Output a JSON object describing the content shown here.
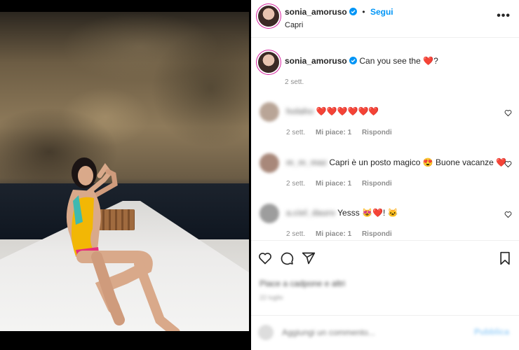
{
  "post": {
    "username": "sonia_amoruso",
    "follow_label": "Segui",
    "location": "Capri",
    "more_label": "•••"
  },
  "caption": {
    "username": "sonia_amoruso",
    "text": "Can you see the",
    "emoji": "❤️",
    "suffix": "?",
    "time": "2 sett."
  },
  "comments": [
    {
      "author": "holaho",
      "text": "❤️❤️❤️❤️❤️❤️",
      "time": "2 sett.",
      "likes": "Mi piace: 1",
      "reply": "Rispondi"
    },
    {
      "author": "m_m_maz",
      "text": "Capri è un posto magico 😍 Buone vacanze ❤️",
      "time": "2 sett.",
      "likes": "Mi piace: 1",
      "reply": "Rispondi"
    },
    {
      "author": "a.ciel_dauro",
      "text": "Yesss 😻❤️! 🐱",
      "time": "2 sett.",
      "likes": "Mi piace: 1",
      "reply": "Rispondi"
    }
  ],
  "engagement": {
    "likes_text": "Piace a cadpone e altri",
    "date_text": "22 luglio"
  },
  "add_comment": {
    "placeholder": "Aggiungi un commento...",
    "post_label": "Pubblica"
  },
  "colors": {
    "accent": "#0095f6",
    "heart": "#e0245e",
    "meta": "#8e8e8e"
  },
  "icons": [
    "verified-icon",
    "more-icon",
    "heart-icon",
    "comment-icon",
    "share-icon",
    "save-icon",
    "emoji-icon"
  ]
}
